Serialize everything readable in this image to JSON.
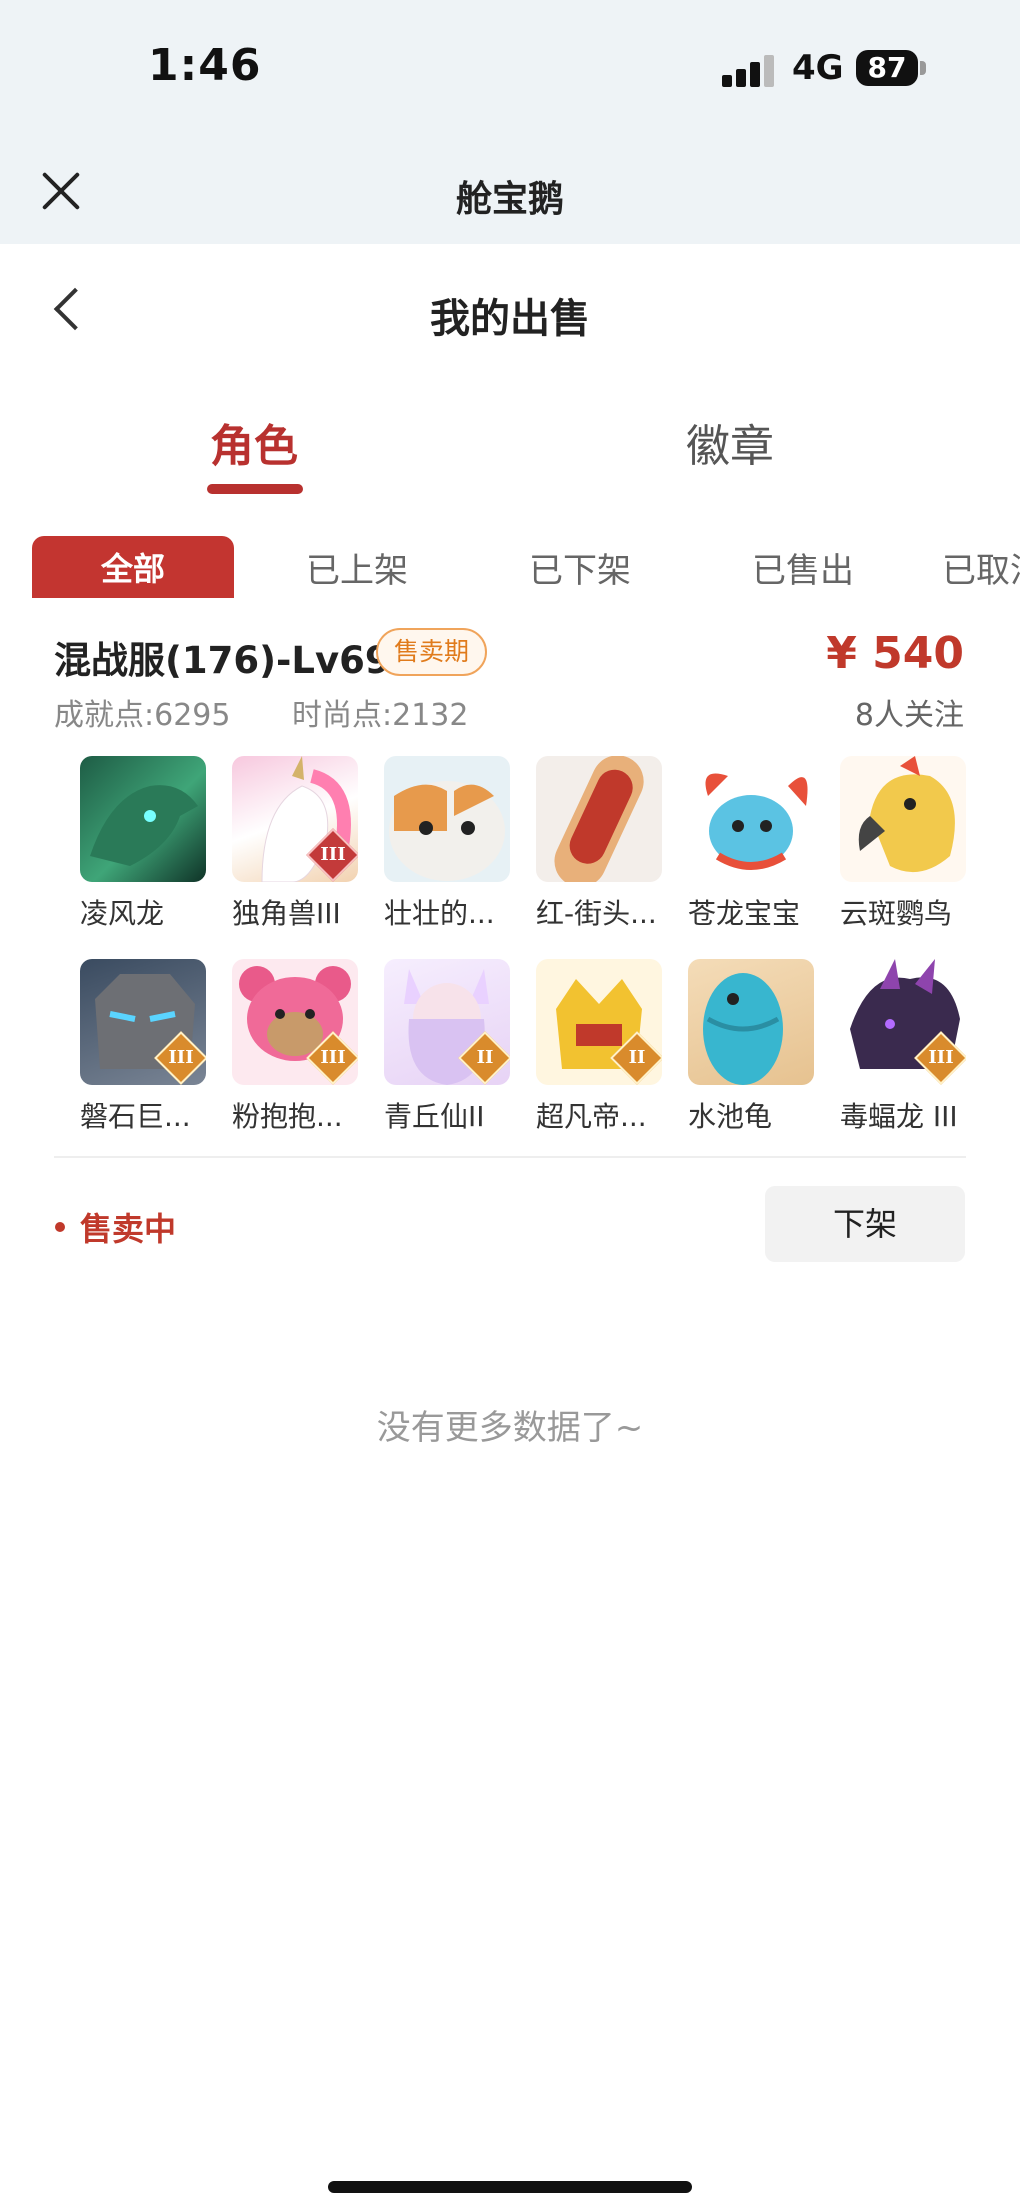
{
  "status_bar": {
    "time": "1:46",
    "network": "4G",
    "battery": "87"
  },
  "app_bar": {
    "title": "舱宝鹅"
  },
  "page": {
    "title": "我的出售"
  },
  "main_tabs": [
    {
      "label": "角色",
      "active": true
    },
    {
      "label": "徽章",
      "active": false
    }
  ],
  "filter_tabs": [
    {
      "label": "全部",
      "active": true
    },
    {
      "label": "已上架"
    },
    {
      "label": "已下架"
    },
    {
      "label": "已售出"
    },
    {
      "label": "已取消"
    }
  ],
  "listing": {
    "title": "混战服(176)-Lv69",
    "tag": "售卖期",
    "price": "¥ 540",
    "achievement": "成就点:6295",
    "fashion": "时尚点:2132",
    "followers": "8人关注",
    "status": "售卖中",
    "delist_label": "下架",
    "items": [
      {
        "name": "凌风龙",
        "icon": "dragon-icon"
      },
      {
        "name": "独角兽III",
        "icon": "unicorn-icon"
      },
      {
        "name": "壮壮的...",
        "icon": "cat-icon"
      },
      {
        "name": "红-街头...",
        "icon": "skateboard-icon"
      },
      {
        "name": "苍龙宝宝",
        "icon": "baby-dragon-icon"
      },
      {
        "name": "云斑鹦鸟",
        "icon": "parrot-icon"
      },
      {
        "name": "磐石巨...",
        "icon": "rock-golem-icon"
      },
      {
        "name": "粉抱抱...",
        "icon": "pink-bear-icon"
      },
      {
        "name": "青丘仙II",
        "icon": "fox-fairy-icon"
      },
      {
        "name": "超凡帝...",
        "icon": "crown-icon"
      },
      {
        "name": "水池龟",
        "icon": "turtle-icon"
      },
      {
        "name": "毒蝠龙 III",
        "icon": "bat-dragon-icon"
      }
    ]
  },
  "footer": {
    "no_more": "没有更多数据了~"
  },
  "colors": {
    "accent": "#c0392b",
    "tag_orange": "#e07b1c",
    "top_bg": "#eef3f6"
  }
}
